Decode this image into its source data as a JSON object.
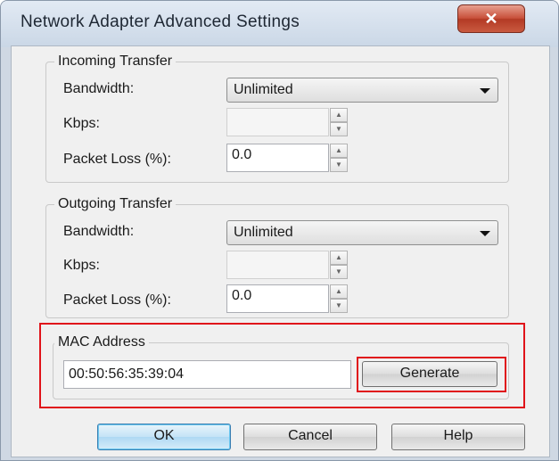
{
  "window": {
    "title": "Network Adapter Advanced Settings",
    "close_glyph": "✕"
  },
  "incoming": {
    "legend": "Incoming Transfer",
    "bandwidth_label": "Bandwidth:",
    "bandwidth_value": "Unlimited",
    "kbps_label": "Kbps:",
    "kbps_value": "",
    "loss_label": "Packet Loss (%):",
    "loss_value": "0.0"
  },
  "outgoing": {
    "legend": "Outgoing Transfer",
    "bandwidth_label": "Bandwidth:",
    "bandwidth_value": "Unlimited",
    "kbps_label": "Kbps:",
    "kbps_value": "",
    "loss_label": "Packet Loss (%):",
    "loss_value": "0.0"
  },
  "mac": {
    "legend": "MAC Address",
    "value": "00:50:56:35:39:04",
    "generate_label": "Generate"
  },
  "buttons": {
    "ok": "OK",
    "cancel": "Cancel",
    "help": "Help"
  },
  "colors": {
    "highlight": "#e0131a",
    "title_text": "#1e2733",
    "close_button": "#c8503a"
  },
  "icons": {
    "close": "close-icon",
    "spin_up": "spin-up-icon",
    "spin_down": "spin-down-icon",
    "dropdown": "chevron-down-icon"
  }
}
